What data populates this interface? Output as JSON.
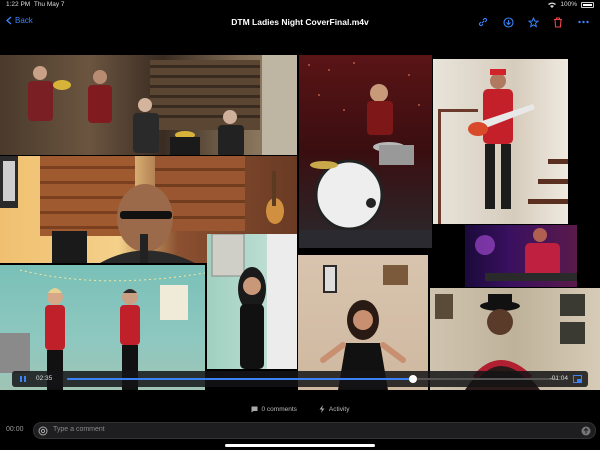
{
  "status_bar": {
    "time": "1:22 PM",
    "date": "Thu May 7",
    "battery": "100%",
    "icons": [
      "wifi-icon",
      "battery-icon"
    ]
  },
  "topbar": {
    "back_label": "Back",
    "title": "DTM Ladies Night CoverFinal.m4v",
    "icons": [
      "link-icon",
      "download-icon",
      "star-icon",
      "trash-icon",
      "more-icon"
    ],
    "accent": "#3b82f6",
    "danger": "#ef4444"
  },
  "player": {
    "elapsed": "02:35",
    "remaining": "-01:04",
    "progress": 0.707,
    "play_icon": "pause-icon",
    "pip_icon": "picture-in-picture-icon"
  },
  "meta": {
    "comments": "0 comments",
    "activity": "Activity"
  },
  "footer": {
    "timer": "00:00",
    "comment_placeholder": "Type a comment"
  }
}
